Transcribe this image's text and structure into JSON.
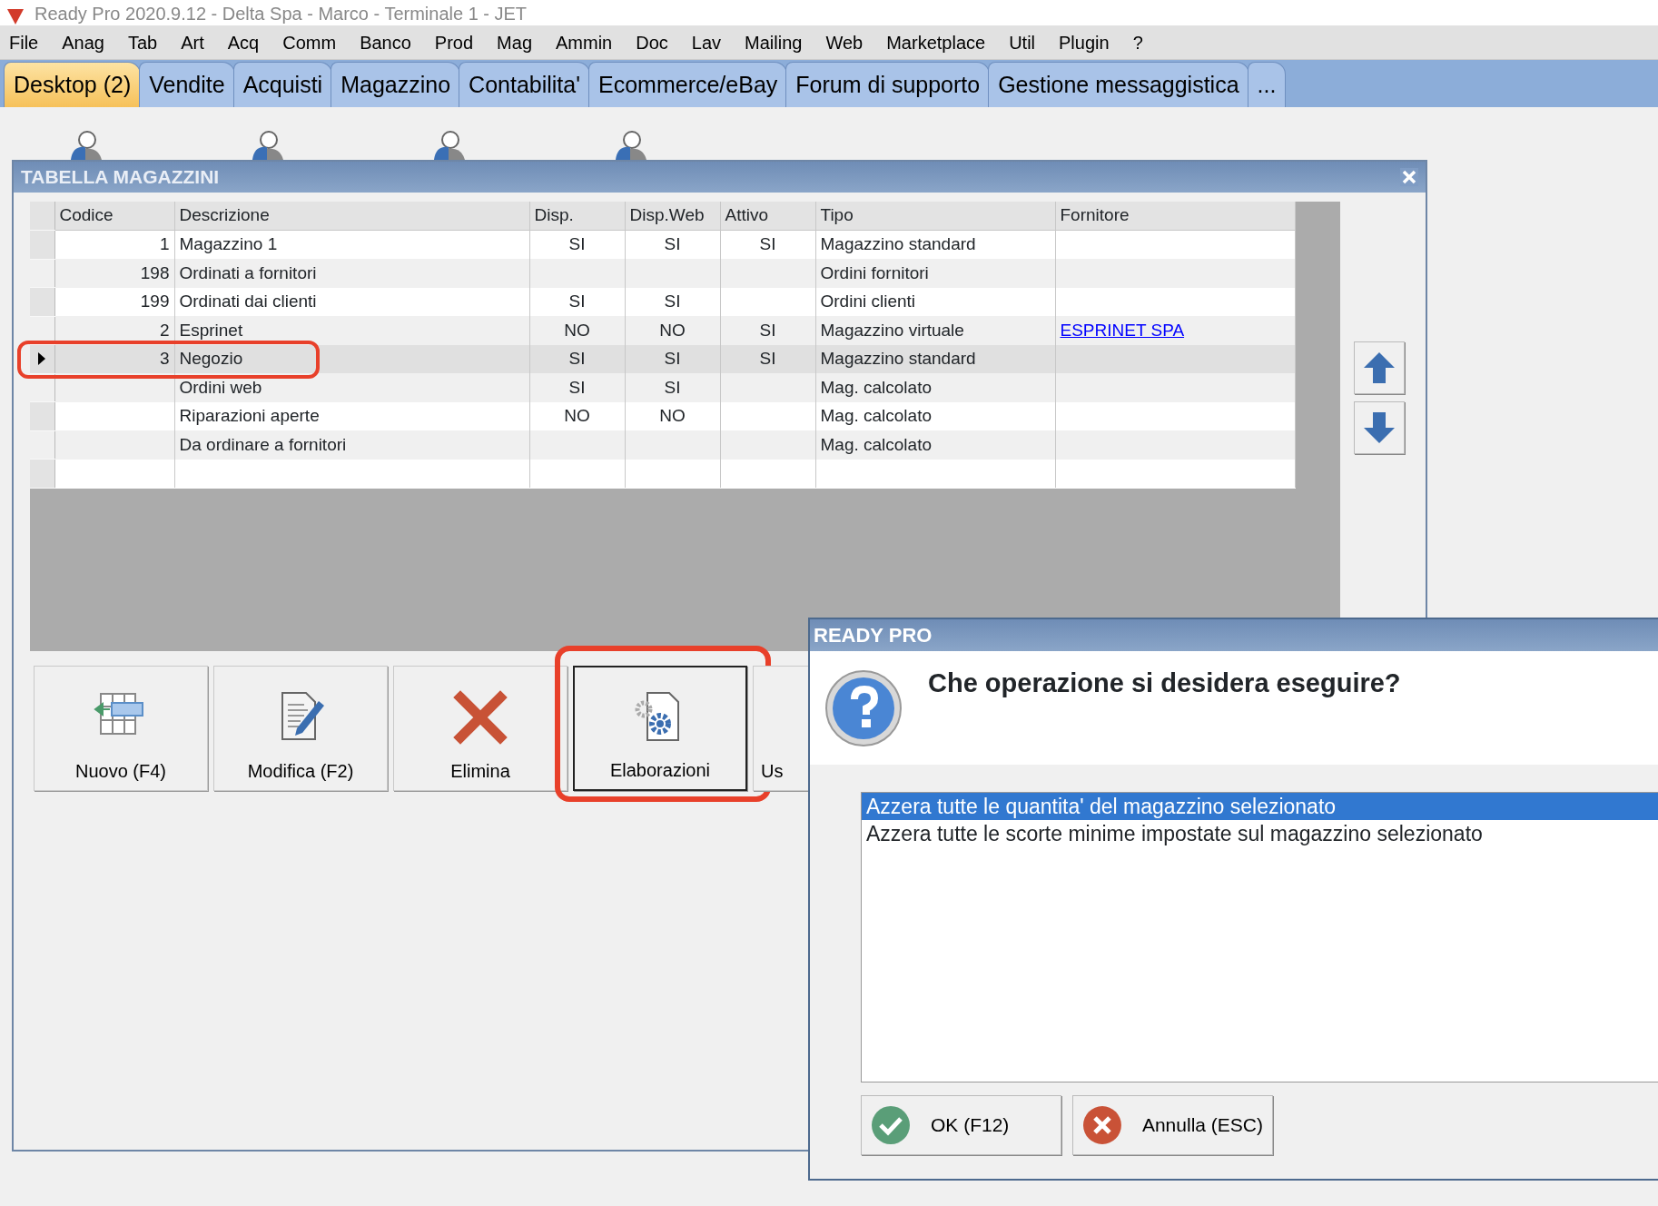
{
  "window": {
    "title": "Ready Pro 2020.9.12 - Delta Spa - Marco - Terminale 1 - JET"
  },
  "menu": [
    "File",
    "Anag",
    "Tab",
    "Art",
    "Acq",
    "Comm",
    "Banco",
    "Prod",
    "Mag",
    "Ammin",
    "Doc",
    "Lav",
    "Mailing",
    "Web",
    "Marketplace",
    "Util",
    "Plugin",
    "?"
  ],
  "tabs": [
    {
      "label": "Desktop (2)",
      "selected": true
    },
    {
      "label": "Vendite",
      "selected": false
    },
    {
      "label": "Acquisti",
      "selected": false
    },
    {
      "label": "Magazzino",
      "selected": false
    },
    {
      "label": "Contabilita'",
      "selected": false
    },
    {
      "label": "Ecommerce/eBay",
      "selected": false
    },
    {
      "label": "Forum di supporto",
      "selected": false
    },
    {
      "label": "Gestione messaggistica",
      "selected": false
    },
    {
      "label": "...",
      "selected": false
    }
  ],
  "panel": {
    "title": "TABELLA MAGAZZINI",
    "columns": [
      "Codice",
      "Descrizione",
      "Disp.",
      "Disp.Web",
      "Attivo",
      "Tipo",
      "Fornitore"
    ],
    "rows": [
      {
        "selected": false,
        "highlighted": false,
        "cells": [
          "1",
          "Magazzino 1",
          "SI",
          "SI",
          "SI",
          "Magazzino standard",
          null
        ]
      },
      {
        "selected": false,
        "highlighted": false,
        "cells": [
          "198",
          "Ordinati a fornitori",
          null,
          null,
          null,
          "Ordini fornitori",
          null
        ]
      },
      {
        "selected": false,
        "highlighted": false,
        "cells": [
          "199",
          "Ordinati dai clienti",
          "SI",
          "SI",
          null,
          "Ordini clienti",
          null
        ]
      },
      {
        "selected": false,
        "highlighted": false,
        "cells": [
          "2",
          "Esprinet",
          "NO",
          "NO",
          "SI",
          "Magazzino virtuale",
          "ESPRINET SPA"
        ]
      },
      {
        "selected": true,
        "highlighted": true,
        "cells": [
          "3",
          "Negozio",
          "SI",
          "SI",
          "SI",
          "Magazzino standard",
          null
        ]
      },
      {
        "selected": false,
        "highlighted": false,
        "cells": [
          null,
          "Ordini web",
          "SI",
          "SI",
          null,
          "Mag. calcolato",
          null
        ]
      },
      {
        "selected": false,
        "highlighted": false,
        "cells": [
          null,
          "Riparazioni aperte",
          "NO",
          "NO",
          null,
          "Mag. calcolato",
          null
        ]
      },
      {
        "selected": false,
        "highlighted": false,
        "cells": [
          null,
          "Da ordinare a fornitori",
          null,
          null,
          null,
          "Mag. calcolato",
          null
        ]
      }
    ],
    "buttons": [
      {
        "label": "Nuovo (F4)",
        "kind": "new",
        "focused": false,
        "highlighted": false
      },
      {
        "label": "Modifica (F2)",
        "kind": "edit",
        "focused": false,
        "highlighted": false
      },
      {
        "label": "Elimina",
        "kind": "delete",
        "focused": false,
        "highlighted": false
      },
      {
        "label": "Elaborazioni",
        "kind": "process",
        "focused": true,
        "highlighted": true
      },
      {
        "label": "Us",
        "kind": "other",
        "focused": false,
        "highlighted": false
      }
    ]
  },
  "dialog": {
    "title": "READY PRO",
    "question": "Che operazione si desidera eseguire?",
    "options": [
      {
        "label": "Azzera tutte le quantita' del magazzino selezionato",
        "selected": true
      },
      {
        "label": "Azzera tutte le scorte minime impostate sul magazzino selezionato",
        "selected": false
      }
    ],
    "buttons": [
      {
        "label": "OK (F12)",
        "kind": "ok"
      },
      {
        "label": "Annulla (ESC)",
        "kind": "cancel"
      }
    ]
  }
}
